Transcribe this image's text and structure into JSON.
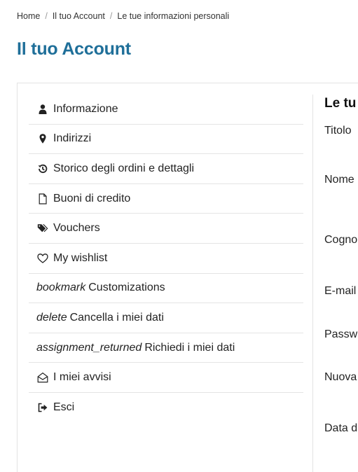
{
  "breadcrumb": {
    "items": [
      "Home",
      "Il tuo Account",
      "Le tue informazioni personali"
    ]
  },
  "page_title": "Il tuo Account",
  "menu": {
    "items": [
      {
        "icon": "user-icon",
        "label": "Informazione"
      },
      {
        "icon": "map-pin-icon",
        "label": "Indirizzi"
      },
      {
        "icon": "history-icon",
        "label": "Storico degli ordini e dettagli"
      },
      {
        "icon": "file-icon",
        "label": "Buoni di credito"
      },
      {
        "icon": "tags-icon",
        "label": "Vouchers"
      },
      {
        "icon": "heart-icon",
        "label": "My wishlist"
      },
      {
        "ligature": "bookmark",
        "label": "Customizations"
      },
      {
        "ligature": "delete",
        "label": "Cancella i miei dati"
      },
      {
        "ligature": "assignment_returned",
        "label": "Richiedi i miei dati"
      },
      {
        "icon": "envelope-open-icon",
        "label": "I miei avvisi"
      },
      {
        "icon": "sign-out-icon",
        "label": "Esci"
      }
    ]
  },
  "form": {
    "title": "Le tu",
    "labels": [
      "Titolo",
      "Nome",
      "Cogno",
      "E-mail",
      "Passw",
      "Nuova",
      "Data d"
    ]
  }
}
